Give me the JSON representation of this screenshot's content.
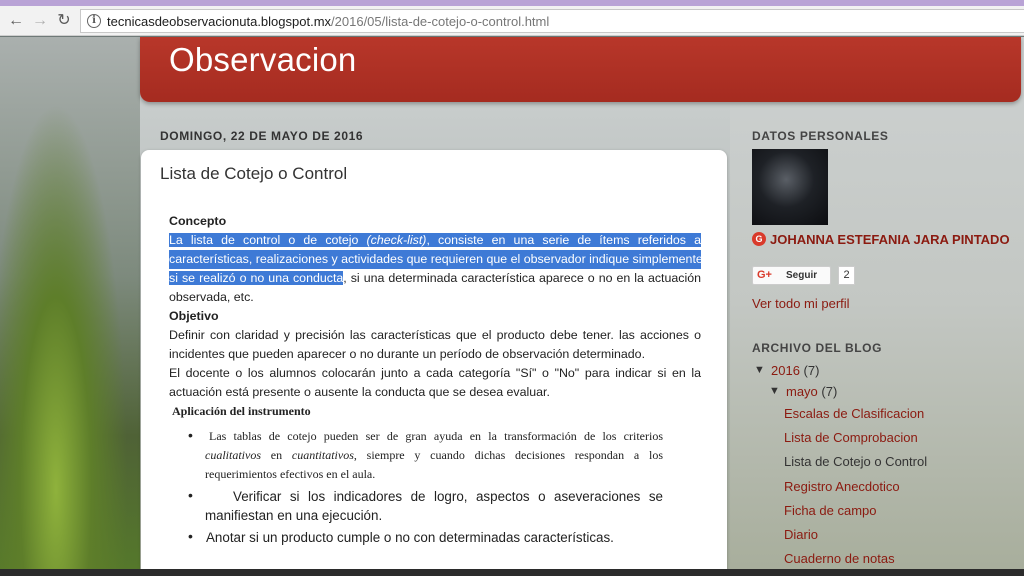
{
  "browser": {
    "back_icon": "←",
    "forward_icon": "→",
    "reload_icon": "↻",
    "info_icon": "i",
    "url_host": "tecnicasdeobservacionuta.blogspot.mx",
    "url_path": "/2016/05/lista-de-cotejo-o-control.html"
  },
  "header": {
    "title": "Observacion"
  },
  "post": {
    "date": "DOMINGO, 22 DE MAYO DE 2016",
    "title": "Lista de Cotejo o Control",
    "concepto_heading": "Concepto",
    "concepto_l1a": "La lista de control o de cotejo ",
    "concepto_l1b": "(check-list)",
    "concepto_l1c": ", consiste en una serie de ítems referidos a",
    "concepto_l2": "características, realizaciones y actividades que requieren que el observador indique simplemente",
    "concepto_l3a": "si se realizó o no una conducta",
    "concepto_l3b": ", si una determinada característica aparece o no en la actuación",
    "concepto_l4": "observada, etc.",
    "objetivo_heading": "Objetivo",
    "objetivo_l1": "Definir con claridad y precisión las características que el producto debe tener. las acciones o",
    "objetivo_l2": "incidentes que pueden aparecer o no durante un período de observación determinado.",
    "objetivo_l3": "El docente o los alumnos colocarán junto a cada categoría \"Sí\" o \"No\" para indicar si en la",
    "objetivo_l4": "actuación está presente o ausente la conducta que se desea evaluar.",
    "aplicacion_heading": "Aplicación del instrumento",
    "bullet1_l1": "Las tablas de cotejo pueden ser de gran ayuda en la transformación de los criterios",
    "bullet1_l2a": "cualitativos",
    "bullet1_l2b": " en ",
    "bullet1_l2c": "cuantitativos",
    "bullet1_l2d": ", siempre y cuando dichas decisiones respondan a los",
    "bullet1_l3": "requerimientos efectivos en el aula.",
    "bullet2_l1": "Verificar si los indicadores de logro, aspectos o aseveraciones se",
    "bullet2_l2": "manifiestan en una ejecución.",
    "bullet3_l1": "Anotar si un producto cumple o no con determinadas características."
  },
  "sidebar": {
    "personal_heading": "DATOS PERSONALES",
    "profile_name": "JOHANNA ESTEFANIA JARA PINTADO",
    "gplus_icon": "G",
    "follow_g": "G+",
    "follow_label": "Seguir",
    "follow_count": "2",
    "profile_link": "Ver todo mi perfil",
    "archive_heading": "ARCHIVO DEL BLOG",
    "year": {
      "label": "2016",
      "count": "(7)"
    },
    "month": {
      "label": "mayo",
      "count": "(7)"
    },
    "posts": [
      "Escalas de Clasificacion",
      "Lista de Comprobacion",
      "Lista de Cotejo o Control",
      "Registro Anecdotico",
      "Ficha de campo",
      "Diario",
      "Cuaderno de notas"
    ]
  }
}
